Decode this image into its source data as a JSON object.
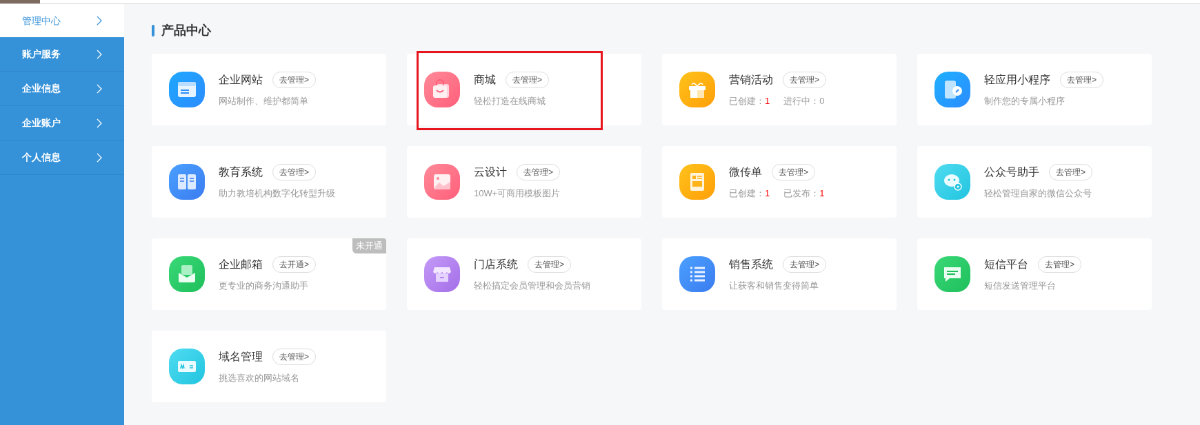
{
  "sidebar": {
    "items": [
      {
        "label": "管理中心",
        "selected": true
      },
      {
        "label": "账户服务",
        "selected": false
      },
      {
        "label": "企业信息",
        "selected": false
      },
      {
        "label": "企业账户",
        "selected": false
      },
      {
        "label": "个人信息",
        "selected": false
      }
    ]
  },
  "section_title": "产品中心",
  "cards": [
    {
      "kind": "browser",
      "title": "企业网站",
      "action": "去管理>",
      "description": "网站制作、维护都简单",
      "highlighted": false
    },
    {
      "kind": "bag",
      "title": "商城",
      "action": "去管理>",
      "description": "轻松打造在线商城",
      "highlighted": true
    },
    {
      "kind": "gift",
      "title": "营销活动",
      "action": "去管理>",
      "stats": [
        {
          "label": "已创建：",
          "value": "1",
          "alert": true
        },
        {
          "label": "进行中：",
          "value": "0",
          "alert": false
        }
      ],
      "highlighted": false
    },
    {
      "kind": "miniapp",
      "title": "轻应用小程序",
      "action": "去管理>",
      "description": "制作您的专属小程序",
      "highlighted": false
    },
    {
      "kind": "book",
      "title": "教育系统",
      "action": "去管理>",
      "description": "助力教培机构数字化转型升级",
      "highlighted": false
    },
    {
      "kind": "image",
      "title": "云设计",
      "action": "去管理>",
      "description": "10W+可商用模板图片",
      "highlighted": false
    },
    {
      "kind": "flyer",
      "title": "微传单",
      "action": "去管理>",
      "stats": [
        {
          "label": "已创建：",
          "value": "1",
          "alert": true
        },
        {
          "label": "已发布：",
          "value": "1",
          "alert": true
        }
      ],
      "highlighted": false
    },
    {
      "kind": "chat",
      "title": "公众号助手",
      "action": "去管理>",
      "description": "轻松管理自家的微信公众号",
      "highlighted": false
    },
    {
      "kind": "mail",
      "title": "企业邮箱",
      "action": "去开通>",
      "description": "更专业的商务沟通助手",
      "badge": "未开通",
      "highlighted": false
    },
    {
      "kind": "store",
      "title": "门店系统",
      "action": "去管理>",
      "description": "轻松搞定会员管理和会员营销",
      "highlighted": false
    },
    {
      "kind": "list",
      "title": "销售系统",
      "action": "去管理>",
      "description": "让获客和销售变得简单",
      "highlighted": false
    },
    {
      "kind": "message",
      "title": "短信平台",
      "action": "去管理>",
      "description": "短信发送管理平台",
      "highlighted": false
    },
    {
      "kind": "domain",
      "title": "域名管理",
      "action": "去管理>",
      "description": "挑选喜欢的网站域名",
      "highlighted": false
    }
  ]
}
